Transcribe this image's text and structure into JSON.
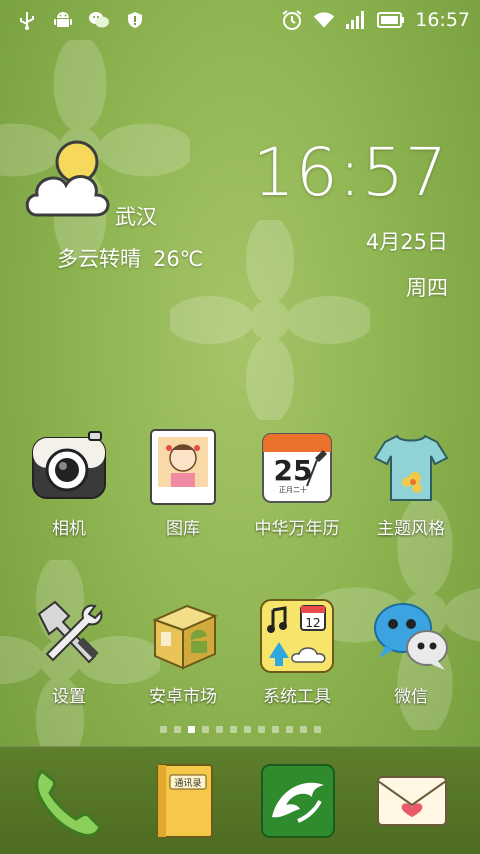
{
  "status_bar": {
    "time": "16:57",
    "icons": [
      "usb-icon",
      "android-debug-icon",
      "wechat-notification-icon",
      "security-shield-icon",
      "alarm-clock-icon",
      "wifi-icon",
      "signal-strength-icon",
      "battery-icon"
    ]
  },
  "weather": {
    "city": "武汉",
    "condition": "多云转晴",
    "temperature": "26℃",
    "icon": "cloudy-sunny-icon"
  },
  "clock": {
    "time": "16:57",
    "date": "4月25日",
    "weekday": "周四"
  },
  "apps": [
    {
      "label": "相机",
      "icon": "camera-icon"
    },
    {
      "label": "图库",
      "icon": "gallery-photo-icon"
    },
    {
      "label": "中华万年历",
      "icon": "calendar-icon",
      "icon_day": "25",
      "icon_subtext": "正月二十"
    },
    {
      "label": "主题风格",
      "icon": "tshirt-icon"
    },
    {
      "label": "设置",
      "icon": "tools-settings-icon"
    },
    {
      "label": "安卓市场",
      "icon": "market-box-icon"
    },
    {
      "label": "系统工具",
      "icon": "system-tools-folder-icon",
      "icon_day": "12"
    },
    {
      "label": "微信",
      "icon": "wechat-icon"
    }
  ],
  "page_indicator": {
    "page_count": 12,
    "active_page": 3
  },
  "dock": {
    "items": [
      "phone-icon",
      "contacts-book-icon",
      "dolphin-browser-icon",
      "envelope-icon"
    ],
    "contacts_icon_text": "通讯录"
  },
  "colors": {
    "wallpaper": "#8fb552",
    "dock": "#5e7f2c",
    "text": "#ffffff"
  }
}
